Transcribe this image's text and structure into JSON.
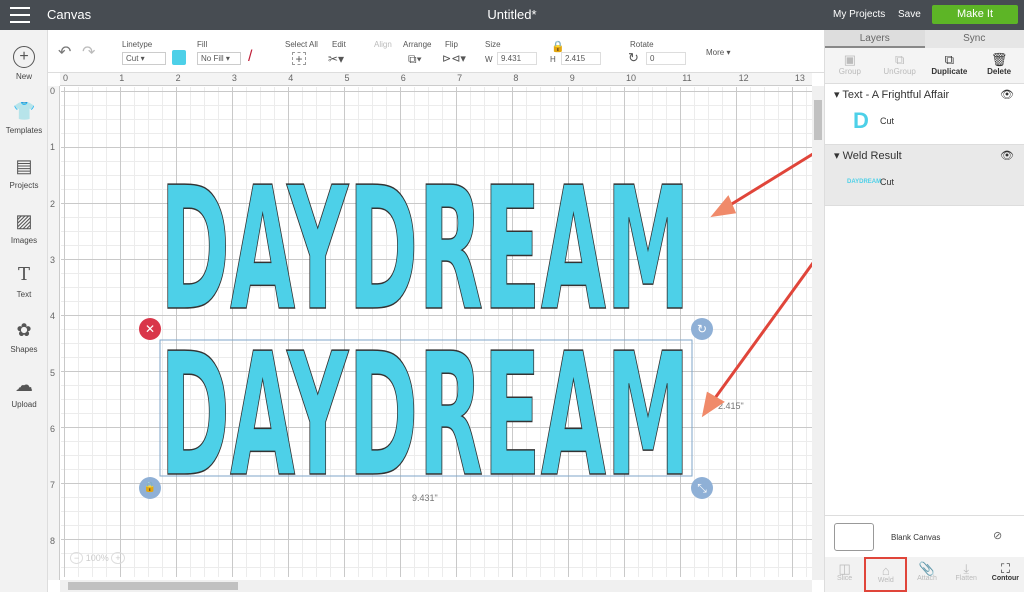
{
  "header": {
    "app": "Canvas",
    "title": "Untitled*",
    "my_projects": "My Projects",
    "save": "Save",
    "make_it": "Make It"
  },
  "sidebar": {
    "items": [
      {
        "label": "New",
        "icon": "plus-circle-icon"
      },
      {
        "label": "Templates",
        "icon": "shirt-icon"
      },
      {
        "label": "Projects",
        "icon": "notebook-icon"
      },
      {
        "label": "Images",
        "icon": "image-icon"
      },
      {
        "label": "Text",
        "icon": "text-icon"
      },
      {
        "label": "Shapes",
        "icon": "shapes-icon"
      },
      {
        "label": "Upload",
        "icon": "cloud-upload-icon"
      }
    ]
  },
  "toolbar": {
    "linetype_label": "Linetype",
    "linetype_value": "Cut",
    "fill_label": "Fill",
    "fill_value": "No Fill",
    "select_all": "Select All",
    "edit": "Edit",
    "align": "Align",
    "arrange": "Arrange",
    "flip": "Flip",
    "size": "Size",
    "w_label": "W",
    "w_value": "9.431",
    "h_label": "H",
    "h_value": "2.415",
    "rotate": "Rotate",
    "rotate_value": "0",
    "more": "More",
    "color": "#4dd0e8"
  },
  "ruler": {
    "h": [
      "0",
      "1",
      "2",
      "3",
      "4",
      "5",
      "6",
      "7",
      "8",
      "9",
      "10",
      "11",
      "12",
      "13"
    ],
    "v": [
      "0",
      "1",
      "2",
      "3",
      "4",
      "5",
      "6",
      "7",
      "8"
    ]
  },
  "canvas": {
    "text_top": "DAYDREAM",
    "text_bottom": "DAYDREAM",
    "width_label": "9.431\"",
    "height_label": "2.415\"",
    "zoom": "100%",
    "text_color": "#4dd0e8"
  },
  "panel": {
    "tabs": [
      "Layers",
      "Sync"
    ],
    "actions": [
      "Group",
      "UnGroup",
      "Duplicate",
      "Delete"
    ],
    "layers": [
      {
        "name": "Text - A Frightful Affair",
        "sub": "Cut",
        "thumb": "D"
      },
      {
        "name": "Weld Result",
        "sub": "Cut",
        "thumb": "DAYDREAM"
      }
    ],
    "blank_canvas": "Blank Canvas",
    "bottom": [
      "Slice",
      "Weld",
      "Attach",
      "Flatten",
      "Contour"
    ]
  },
  "annotation_color": "#e0453a"
}
